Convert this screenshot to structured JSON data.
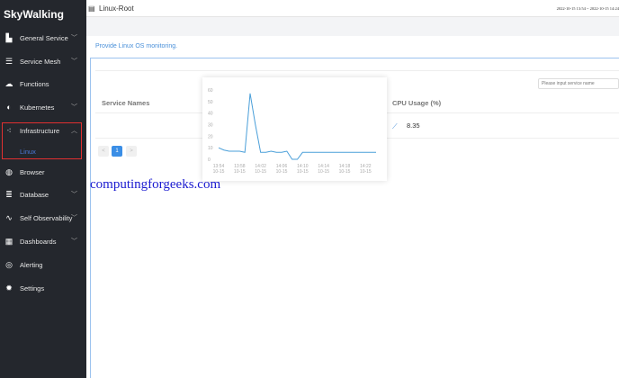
{
  "sidebar": {
    "logo": "SkyWalking",
    "items": [
      {
        "label": "General Service",
        "icon": "bar-chart-icon",
        "chev": true
      },
      {
        "label": "Service Mesh",
        "icon": "mesh-icon",
        "chev": true
      },
      {
        "label": "Functions",
        "icon": "cloud-icon",
        "chev": false
      },
      {
        "label": "Kubernetes",
        "icon": "kubernetes-icon",
        "chev": true
      },
      {
        "label": "Infrastructure",
        "icon": "infrastructure-icon",
        "chev": true,
        "open": true
      },
      {
        "label": "Browser",
        "icon": "globe-icon",
        "chev": false
      },
      {
        "label": "Database",
        "icon": "database-icon",
        "chev": true
      },
      {
        "label": "Self Observability",
        "icon": "self-icon",
        "chev": true
      },
      {
        "label": "Dashboards",
        "icon": "dashboard-icon",
        "chev": true
      },
      {
        "label": "Alerting",
        "icon": "alert-icon",
        "chev": false
      },
      {
        "label": "Settings",
        "icon": "gear-icon",
        "chev": false
      }
    ],
    "sub_item": "Linux"
  },
  "header": {
    "title": "Linux-Root",
    "time_range": "2022-10-15 13:54 ~ 2022-10-15 14:24"
  },
  "description": "Provide Linux OS monitoring.",
  "search": {
    "placeholder": "Please input service name"
  },
  "table": {
    "columns": [
      "Service Names",
      "CPU Usage (%)"
    ],
    "rows": [
      {
        "cpu": "8.35"
      }
    ]
  },
  "pagination": {
    "prev": "<",
    "page": "1",
    "next": ">"
  },
  "watermark": "computingforgeeks.com",
  "accent": "#4a90d9",
  "chart_data": {
    "type": "line",
    "ylim": [
      0,
      60
    ],
    "yticks": [
      0,
      10,
      20,
      30,
      40,
      50,
      60
    ],
    "xticks": [
      "13:54\n10-15",
      "13:58\n10-15",
      "14:02\n10-15",
      "14:06\n10-15",
      "14:10\n10-15",
      "14:14\n10-15",
      "14:18\n10-15",
      "14:22\n10-15"
    ],
    "x": [
      "13:54",
      "13:55",
      "13:56",
      "13:57",
      "13:58",
      "13:59",
      "14:00",
      "14:01",
      "14:02",
      "14:03",
      "14:04",
      "14:05",
      "14:06",
      "14:07",
      "14:08",
      "14:09",
      "14:10",
      "14:11",
      "14:12",
      "14:13",
      "14:14",
      "14:15",
      "14:16",
      "14:17",
      "14:18",
      "14:19",
      "14:20",
      "14:21",
      "14:22",
      "14:23",
      "14:24"
    ],
    "values": [
      10,
      8,
      7,
      7,
      7,
      6,
      57,
      30,
      6,
      6,
      7,
      6,
      6,
      7,
      0,
      0,
      6,
      6,
      6,
      6,
      6,
      6,
      6,
      6,
      6,
      6,
      6,
      6,
      6,
      6,
      6
    ],
    "color": "#4a9fd9"
  }
}
